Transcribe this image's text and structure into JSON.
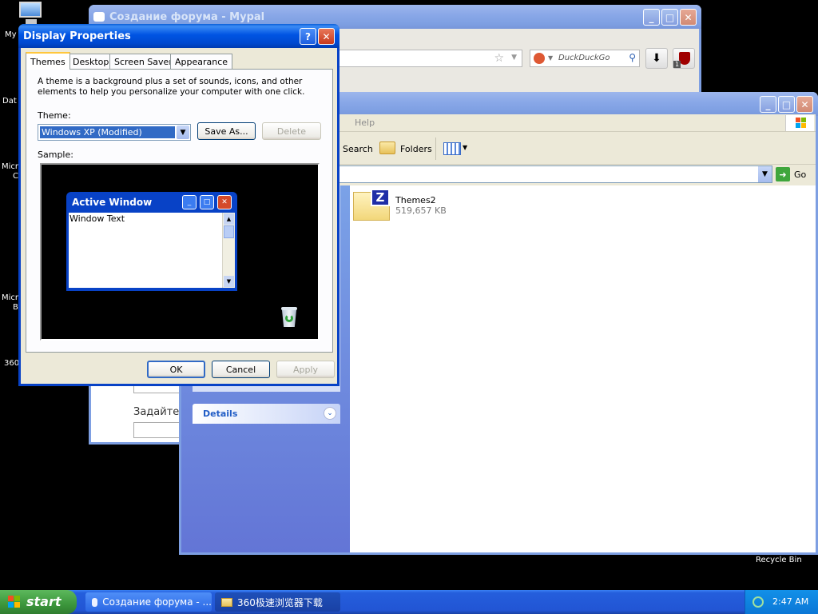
{
  "desktop": {
    "labels": [
      "My",
      "Dat",
      "Micr",
      "C",
      "Micr",
      "B",
      "360"
    ],
    "recycle_bin": "Recycle Bin"
  },
  "forum_window": {
    "title": "Создание форума - Mypal",
    "search_engine": "DuckDuckGo",
    "badge": "1",
    "body_text": "Задайте"
  },
  "explorer": {
    "menu_help": "Help",
    "toolbar_search": "Search",
    "toolbar_folders": "Folders",
    "go_label": "Go",
    "details_label": "Details",
    "file": {
      "name": "Themes2",
      "size": "519,657 KB"
    }
  },
  "dialog": {
    "title": "Display Properties",
    "tabs": [
      "Themes",
      "Desktop",
      "Screen Saver",
      "Appearance"
    ],
    "description": "A theme is a background plus a set of sounds, icons, and other elements to help you personalize your computer with one click.",
    "theme_label": "Theme:",
    "theme_value": "Windows XP (Modified)",
    "save_as": "Save As...",
    "delete": "Delete",
    "sample_label": "Sample:",
    "preview_title": "Active Window",
    "preview_text": "Window Text",
    "ok": "OK",
    "cancel": "Cancel",
    "apply": "Apply"
  },
  "taskbar": {
    "start": "start",
    "items": [
      "Создание форума - ...",
      "360极速浏览器下载"
    ],
    "clock": "2:47 AM"
  }
}
